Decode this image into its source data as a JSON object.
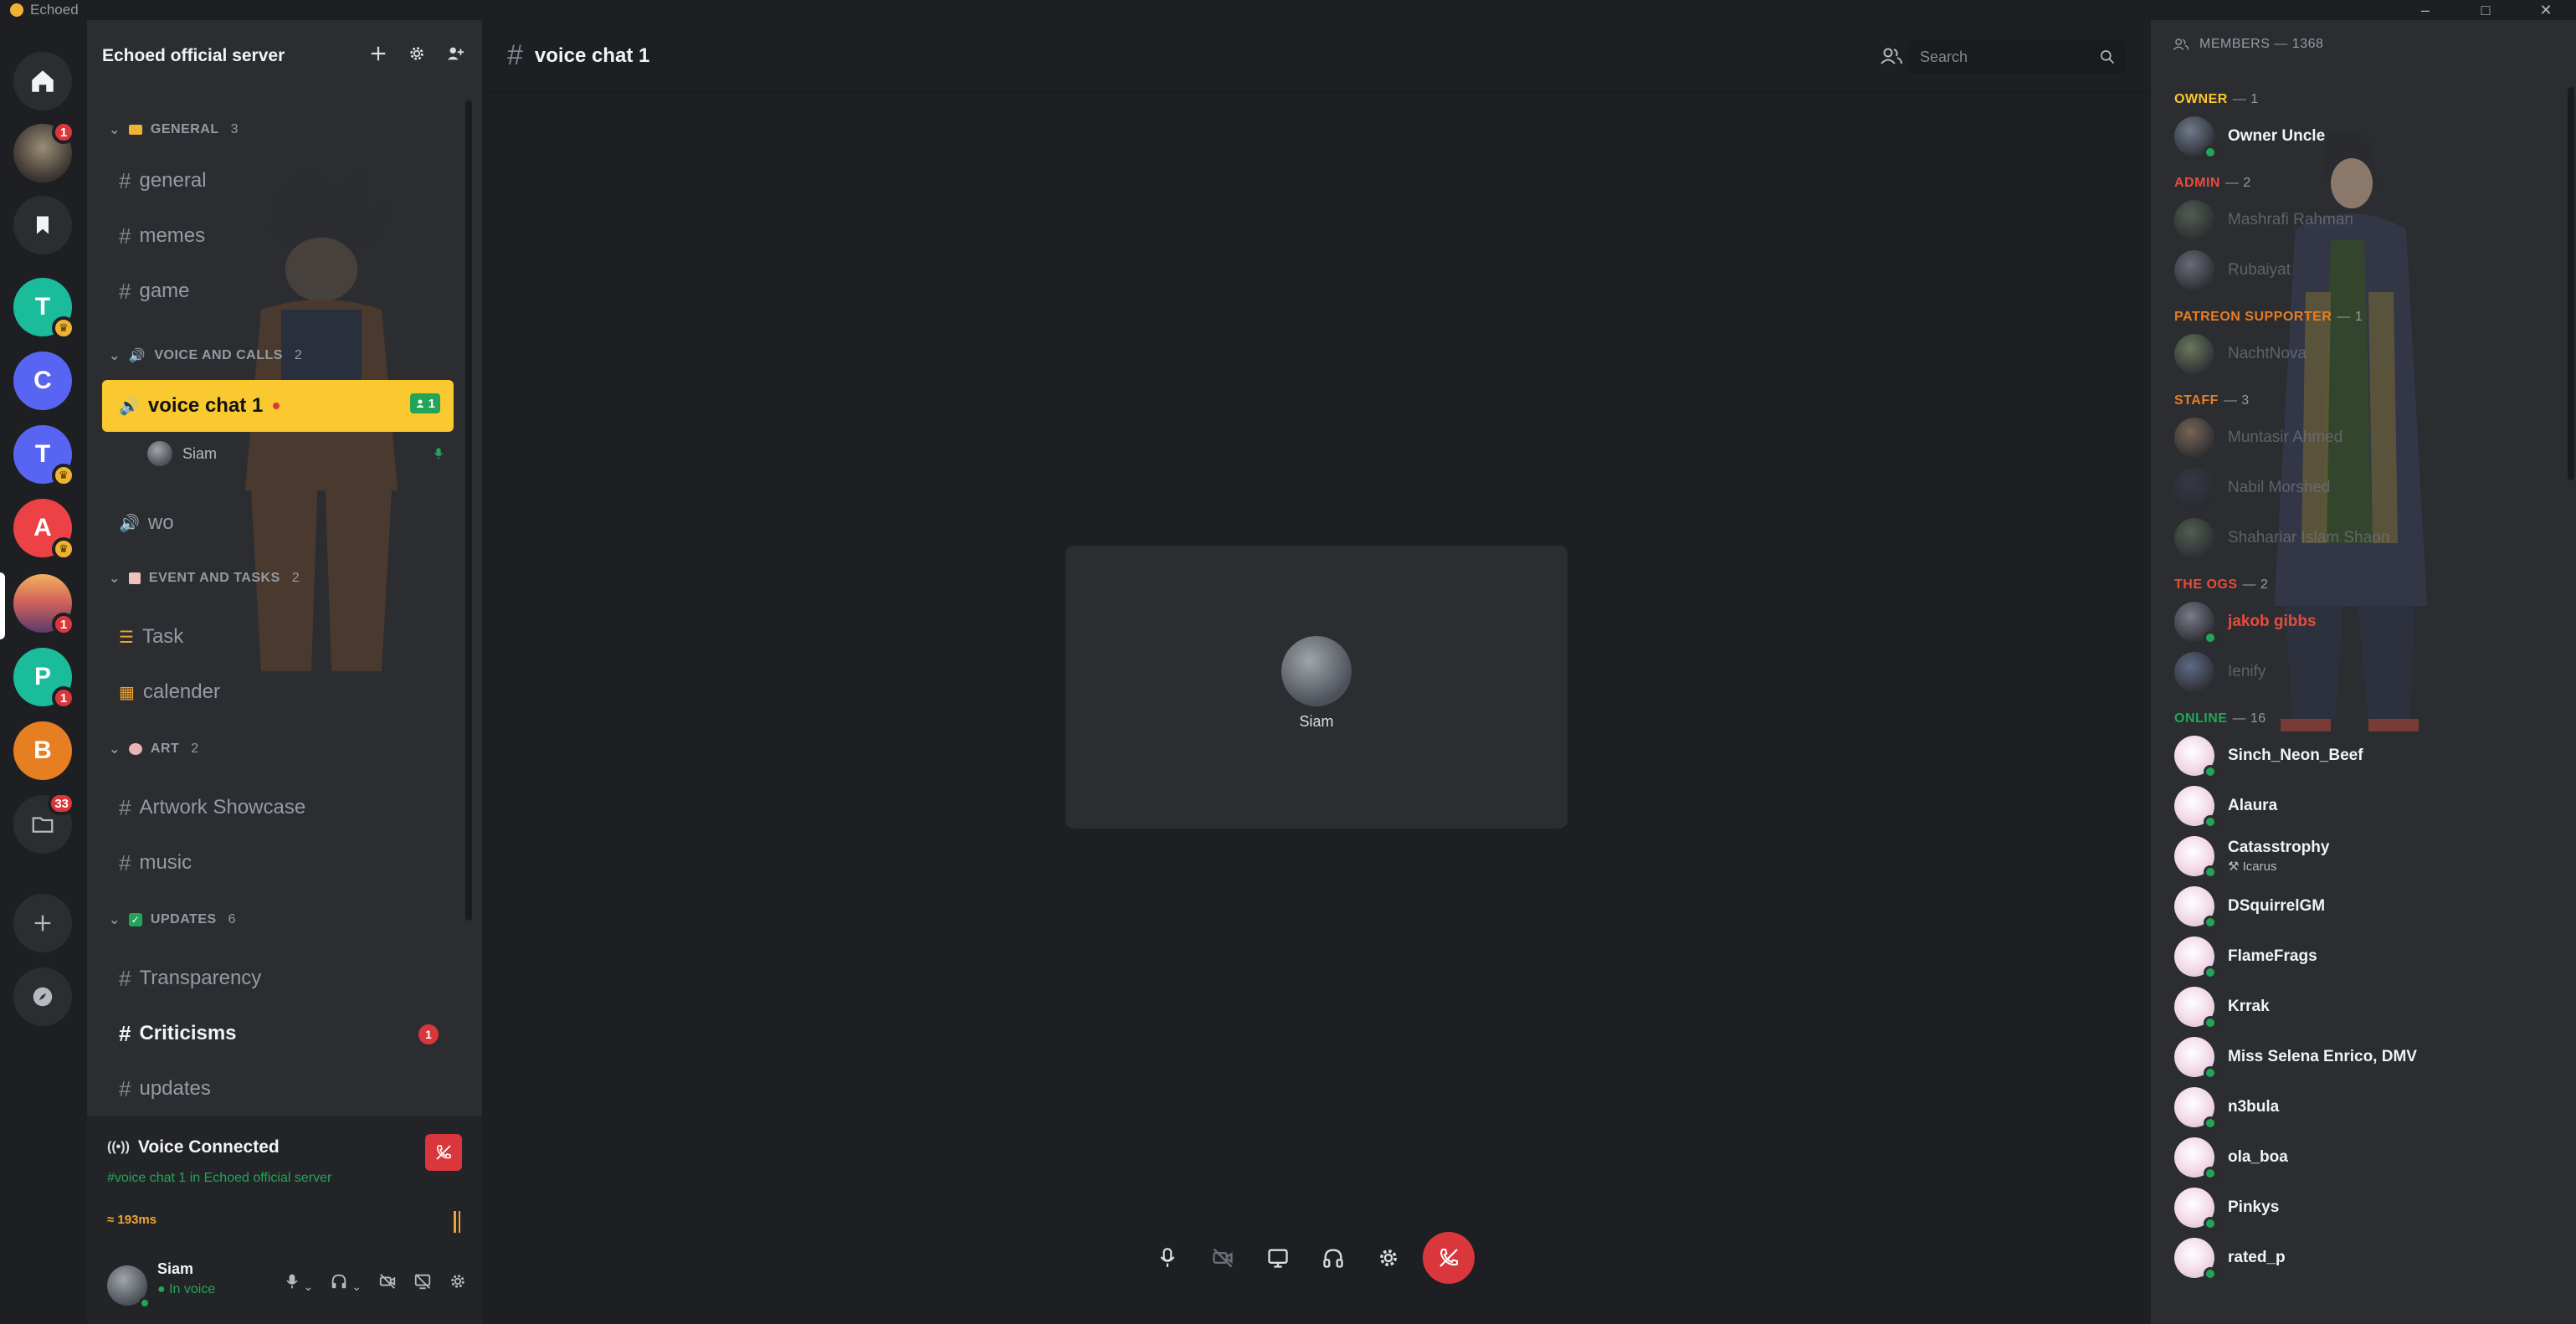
{
  "app": {
    "title": "Echoed",
    "accent": "#f9c92f"
  },
  "rail": {
    "servers": [
      {
        "type": "home",
        "icon": "home-icon"
      },
      {
        "type": "image",
        "badge": "1",
        "color": "#6b5f4d"
      },
      {
        "type": "bookmark",
        "icon": "bookmark-icon"
      },
      {
        "letter": "T",
        "color": "#1abc9c",
        "crown": true
      },
      {
        "letter": "C",
        "color": "#5865f2"
      },
      {
        "letter": "T",
        "color": "#5865f2",
        "crown": true
      },
      {
        "letter": "A",
        "color": "#ed4245",
        "crown": true
      },
      {
        "type": "image",
        "badge": "1",
        "color": "#c05a55",
        "active": true
      },
      {
        "letter": "P",
        "color": "#1abc9c",
        "badge": "1"
      },
      {
        "letter": "B",
        "color": "#e67e22"
      },
      {
        "type": "folder",
        "icon": "folder-icon",
        "badge": "33"
      },
      {
        "type": "add",
        "icon": "plus-icon"
      },
      {
        "type": "explore",
        "icon": "compass-icon"
      }
    ]
  },
  "sidebar": {
    "server_name": "Echoed official server",
    "categories": [
      {
        "name": "GENERAL",
        "count": "3"
      },
      {
        "name": "VOICE AND CALLS",
        "count": "2"
      },
      {
        "name": "EVENT AND TASKS",
        "count": "2"
      },
      {
        "name": "ART",
        "count": "2"
      },
      {
        "name": "UPDATES",
        "count": "6"
      }
    ],
    "channels": {
      "general": "general",
      "memes": "memes",
      "game": "game",
      "voice1": "voice chat 1",
      "voice1_count": "1",
      "voice_user": "Siam",
      "wo": "wo",
      "task": "Task",
      "calender": "calender",
      "artwork": "Artwork Showcase",
      "music": "music",
      "transparency": "Transparency",
      "criticisms": "Criticisms",
      "criticisms_mentions": "1",
      "updates": "updates"
    }
  },
  "voice_panel": {
    "title": "Voice Connected",
    "subtitle": "#voice chat 1 in Echoed official server",
    "ping": "193ms"
  },
  "user_panel": {
    "name": "Siam",
    "status": "In voice"
  },
  "main": {
    "channel_title": "voice chat 1",
    "search_placeholder": "Search",
    "tile_user": "Siam"
  },
  "members": {
    "header": "MEMBERS — 1368",
    "groups": [
      {
        "name": "OWNER",
        "count": "— 1",
        "color": "#f9c92f",
        "members": [
          {
            "name": "Owner Uncle",
            "online": true
          }
        ]
      },
      {
        "name": "ADMIN",
        "count": "— 2",
        "color": "#e74c3c",
        "members": [
          {
            "name": "Mashrafi Rahman",
            "dim": true
          },
          {
            "name": "Rubaiyat",
            "dim": true
          }
        ]
      },
      {
        "name": "PATREON SUPPORTER",
        "count": "— 1",
        "color": "#e67e22",
        "members": [
          {
            "name": "NachtNova",
            "dim": true
          }
        ]
      },
      {
        "name": "STAFF",
        "count": "— 3",
        "color": "#e67e22",
        "members": [
          {
            "name": "Muntasir Ahmed",
            "dim": true
          },
          {
            "name": "Nabil Morshed",
            "dim": true
          },
          {
            "name": "Shahariar Islam Shaon",
            "dim": true
          }
        ]
      },
      {
        "name": "THE OGS",
        "count": "— 2",
        "color": "#e74c3c",
        "members": [
          {
            "name": "jakob gibbs",
            "online": true,
            "color": "#e74c3c"
          },
          {
            "name": "Ienify",
            "dim": true
          }
        ]
      },
      {
        "name": "ONLINE",
        "count": "— 16",
        "color": "#23a559",
        "members": [
          {
            "name": "Sinch_Neon_Beef",
            "online": true
          },
          {
            "name": "Alaura",
            "online": true
          },
          {
            "name": "Catasstrophy",
            "online": true,
            "activity": "Icarus"
          },
          {
            "name": "DSquirrelGM",
            "online": true
          },
          {
            "name": "FlameFrags",
            "online": true
          },
          {
            "name": "Krrak",
            "online": true
          },
          {
            "name": "Miss Selena Enrico, DMV",
            "online": true
          },
          {
            "name": "n3bula",
            "online": true
          },
          {
            "name": "ola_boa",
            "online": true
          },
          {
            "name": "Pinkys",
            "online": true
          },
          {
            "name": "rated_p",
            "online": true
          }
        ]
      }
    ]
  }
}
